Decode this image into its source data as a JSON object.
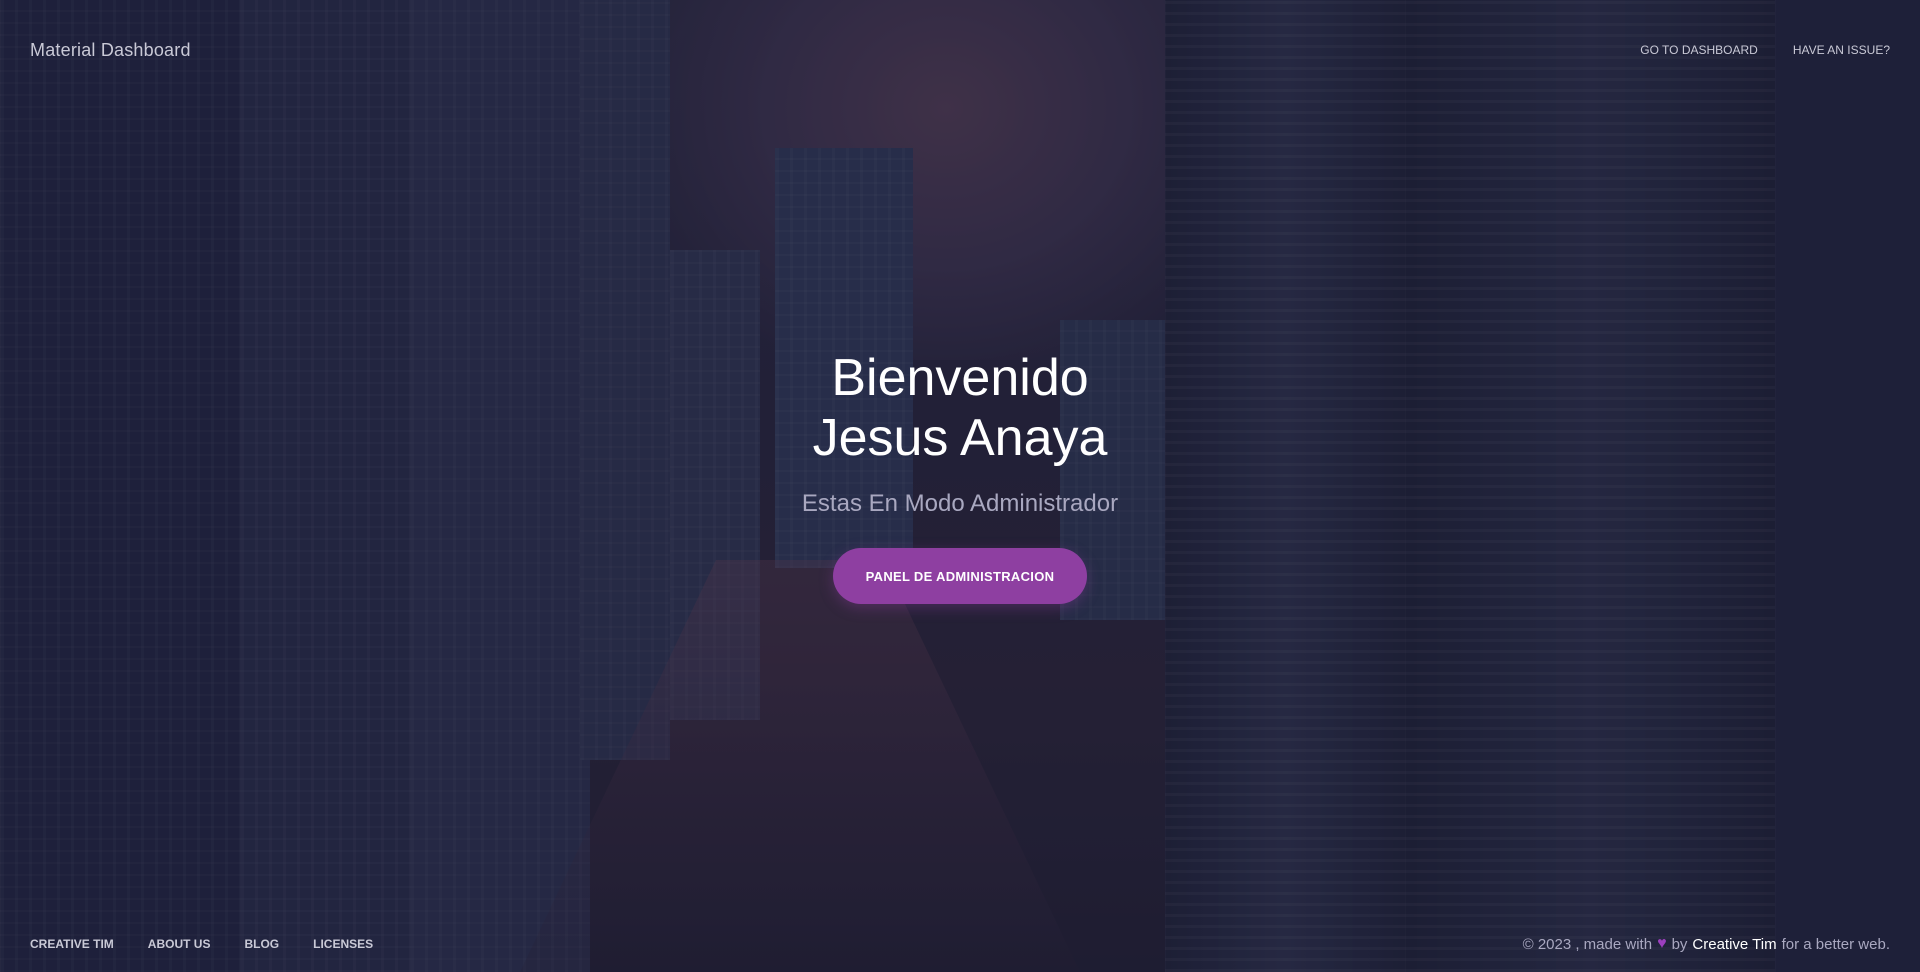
{
  "nav": {
    "brand": "Material Dashboard",
    "links": [
      {
        "label": "GO TO DASHBOARD"
      },
      {
        "label": "HAVE AN ISSUE?"
      }
    ]
  },
  "hero": {
    "title_line1": "Bienvenido",
    "title_line2": "Jesus Anaya",
    "subtitle": "Estas En Modo Administrador",
    "button_label": "PANEL DE ADMINISTRACION"
  },
  "footer": {
    "links": [
      {
        "label": "CREATIVE TIM"
      },
      {
        "label": "ABOUT US"
      },
      {
        "label": "BLOG"
      },
      {
        "label": "LICENSES"
      }
    ],
    "copyright_prefix": "© 2023 , made with",
    "heart_glyph": "♥",
    "by_text": "by",
    "author": "Creative Tim",
    "suffix": "for a better web."
  },
  "colors": {
    "accent": "#8e3fa1",
    "heart": "#9c3fbf"
  },
  "icons": {
    "heart": "heart-icon"
  }
}
